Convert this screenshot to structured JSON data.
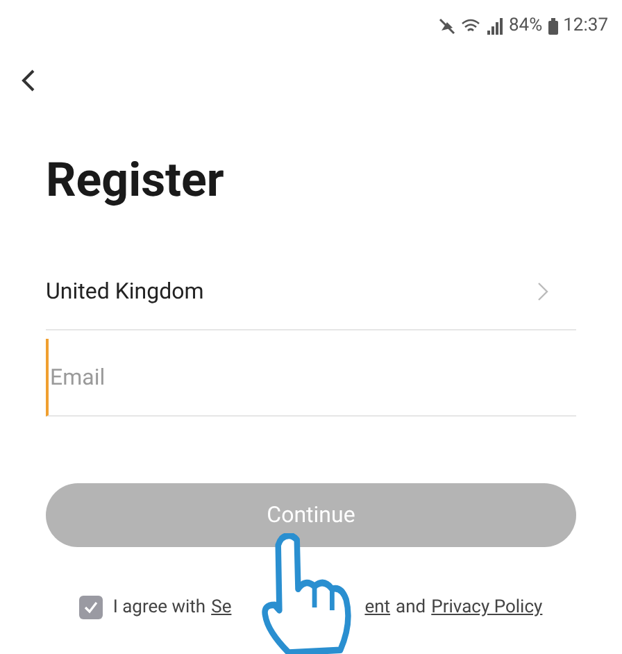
{
  "status_bar": {
    "battery": "84%",
    "time": "12:37"
  },
  "title": "Register",
  "country": {
    "value": "United Kingdom"
  },
  "email": {
    "placeholder": "Email",
    "focused": true
  },
  "continue_button": {
    "label": "Continue",
    "disabled": true
  },
  "agreement": {
    "checked": true,
    "prefix": "I agree with",
    "link_1_start": "Se",
    "link_1_end": "ent",
    "joiner": "and",
    "link_2": "Privacy Policy"
  }
}
